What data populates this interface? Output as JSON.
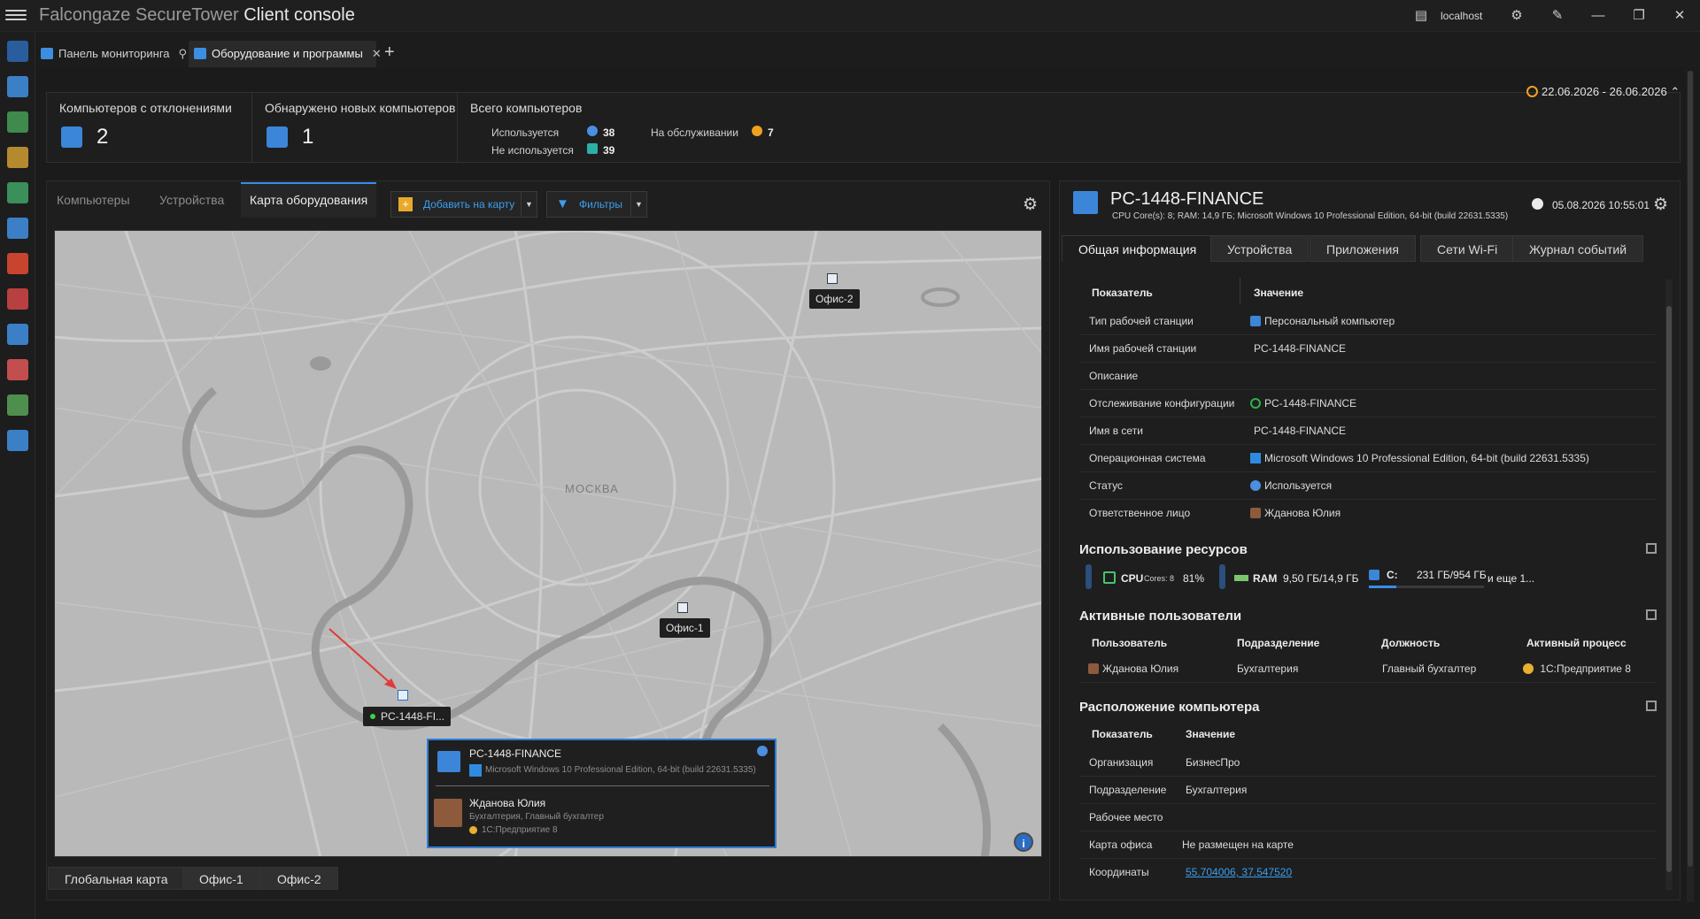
{
  "window": {
    "title_prefix": "Falcongaze SecureTower",
    "title_bold": "Client console",
    "server": "localhost"
  },
  "doc_tabs": [
    {
      "label": "Панель мониторинга"
    },
    {
      "label": "Оборудование и программы"
    }
  ],
  "summary": {
    "deviations_label": "Компьютеров с отклонениями",
    "deviations_count": "2",
    "new_label": "Обнаружено новых компьютеров",
    "new_count": "1",
    "total_label": "Всего компьютеров",
    "in_use_label": "Используется",
    "in_use_count": "38",
    "unused_label": "Не используется",
    "unused_count": "39",
    "service_label": "На обслуживании",
    "service_count": "7",
    "date_range": "22.06.2026 - 26.06.2026"
  },
  "left_tabs": {
    "computers": "Компьютеры",
    "devices": "Устройства",
    "map": "Карта оборудования",
    "add_to_map": "Добавить на карту",
    "filters": "Фильтры"
  },
  "map": {
    "city": "МОСКВА",
    "office1": "Офис-1",
    "office2": "Офис-2",
    "pc_marker": "PC-1448-FI...",
    "popup": {
      "pc_name": "PC-1448-FINANCE",
      "os": "Microsoft Windows 10 Professional Edition, 64-bit (build 22631.5335)",
      "user": "Жданова Юлия",
      "user_sub": "Бухгалтерия, Главный бухгалтер",
      "process": "1С:Предприятие 8"
    },
    "bottom_tabs": [
      "Глобальная карта",
      "Офис-1",
      "Офис-2"
    ]
  },
  "details": {
    "pc_name": "PC-1448-FINANCE",
    "pc_sub": "CPU Core(s): 8; RAM: 14,9 ГБ; Microsoft Windows 10 Professional Edition, 64-bit (build 22631.5335)",
    "date": "05.08.2026 10:55:01",
    "tabs": [
      "Общая информация",
      "Устройства",
      "Приложения",
      "Сети Wi-Fi",
      "Журнал событий"
    ],
    "head_key": "Показатель",
    "head_val": "Значение",
    "rows": [
      {
        "k": "Тип рабочей станции",
        "v": "Персональный компьютер"
      },
      {
        "k": "Имя рабочей станции",
        "v": "PC-1448-FINANCE"
      },
      {
        "k": "Описание",
        "v": ""
      },
      {
        "k": "Отслеживание конфигурации",
        "v": "PC-1448-FINANCE"
      },
      {
        "k": "Имя в сети",
        "v": "PC-1448-FINANCE"
      },
      {
        "k": "Операционная система",
        "v": "Microsoft Windows 10 Professional Edition, 64-bit (build 22631.5335)"
      },
      {
        "k": "Статус",
        "v": "Используется"
      },
      {
        "k": "Ответственное лицо",
        "v": "Жданова Юлия"
      }
    ],
    "resources": {
      "title": "Использование ресурсов",
      "cpu_label": "CPU",
      "cores": "Cores: 8",
      "cpu_pct": "81%",
      "ram_label": "RAM",
      "ram_val": "9,50 ГБ/14,9 ГБ",
      "disk_label": "C:",
      "disk_val": "231 ГБ/954 ГБ",
      "more": "и еще 1..."
    },
    "users": {
      "title": "Активные пользователи",
      "headers": [
        "Пользователь",
        "Подразделение",
        "Должность",
        "Активный процесс"
      ],
      "row": [
        "Жданова Юлия",
        "Бухгалтерия",
        "Главный бухгалтер",
        "1С:Предприятие 8"
      ]
    },
    "location": {
      "title": "Расположение компьютера",
      "head_key": "Показатель",
      "head_val": "Значение",
      "rows": [
        {
          "k": "Организация",
          "v": "БизнесПро"
        },
        {
          "k": "Подразделение",
          "v": "Бухгалтерия"
        },
        {
          "k": "Рабочее место",
          "v": ""
        },
        {
          "k": "Карта офиса",
          "v": "Не размещен на карте"
        },
        {
          "k": "Координаты",
          "v": "55.704006, 37.547520"
        }
      ]
    }
  },
  "colors": {
    "accent": "#3a8ee6",
    "background": "#1b1b1b",
    "map": "#b9b9b9"
  }
}
